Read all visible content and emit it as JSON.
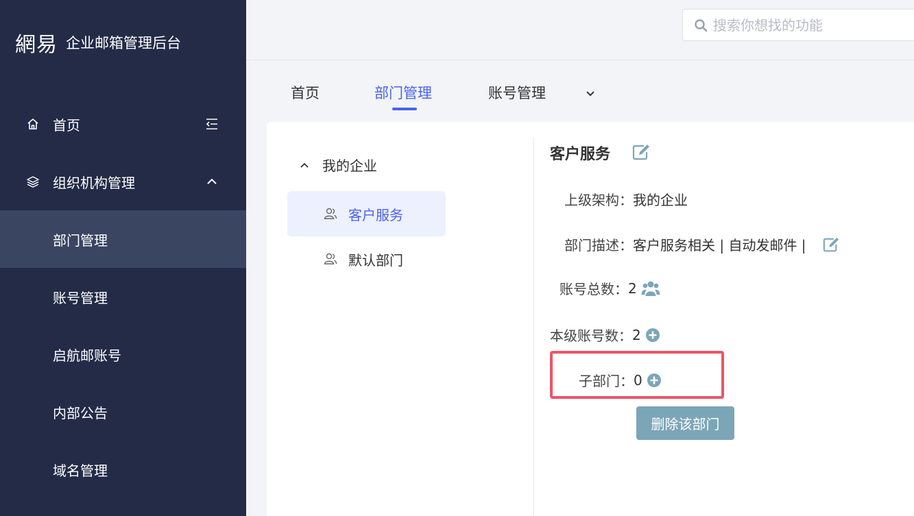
{
  "brand": {
    "logo": "網易",
    "title": "企业邮箱管理后台"
  },
  "sidebar": {
    "items": [
      {
        "label": "首页",
        "icon": "home-icon",
        "right_icon": "collapse-menu-icon"
      },
      {
        "label": "组织机构管理",
        "icon": "layers-icon",
        "right_icon": "chevron-up-icon"
      },
      {
        "label": "部门管理",
        "active": true
      },
      {
        "label": "账号管理"
      },
      {
        "label": "启航邮账号"
      },
      {
        "label": "内部公告"
      },
      {
        "label": "域名管理"
      }
    ]
  },
  "search": {
    "placeholder": "搜索你想找的功能",
    "icon": "search-icon"
  },
  "tabs": [
    {
      "label": "首页"
    },
    {
      "label": "部门管理",
      "active": true
    },
    {
      "label": "账号管理"
    }
  ],
  "tree": {
    "root": "我的企业",
    "nodes": [
      {
        "label": "客户服务",
        "selected": true
      },
      {
        "label": "默认部门"
      }
    ]
  },
  "detail": {
    "title": "客户服务",
    "parent_label": "上级架构：",
    "parent_value": "我的企业",
    "desc_label": "部门描述：",
    "desc_value": "客户服务相关 | 自动发邮件 |",
    "total_label": "账号总数：",
    "total_value": "2",
    "level_label": "本级账号数：",
    "level_value": "2",
    "sub_label": "子部门：",
    "sub_value": "0",
    "delete_button": "删除该部门"
  },
  "colors": {
    "sidebar_bg": "#232b47",
    "sidebar_active": "#3a4561",
    "accent": "#4a63e8",
    "icon_teal": "#7ba6b7",
    "highlight": "#ec5468"
  }
}
